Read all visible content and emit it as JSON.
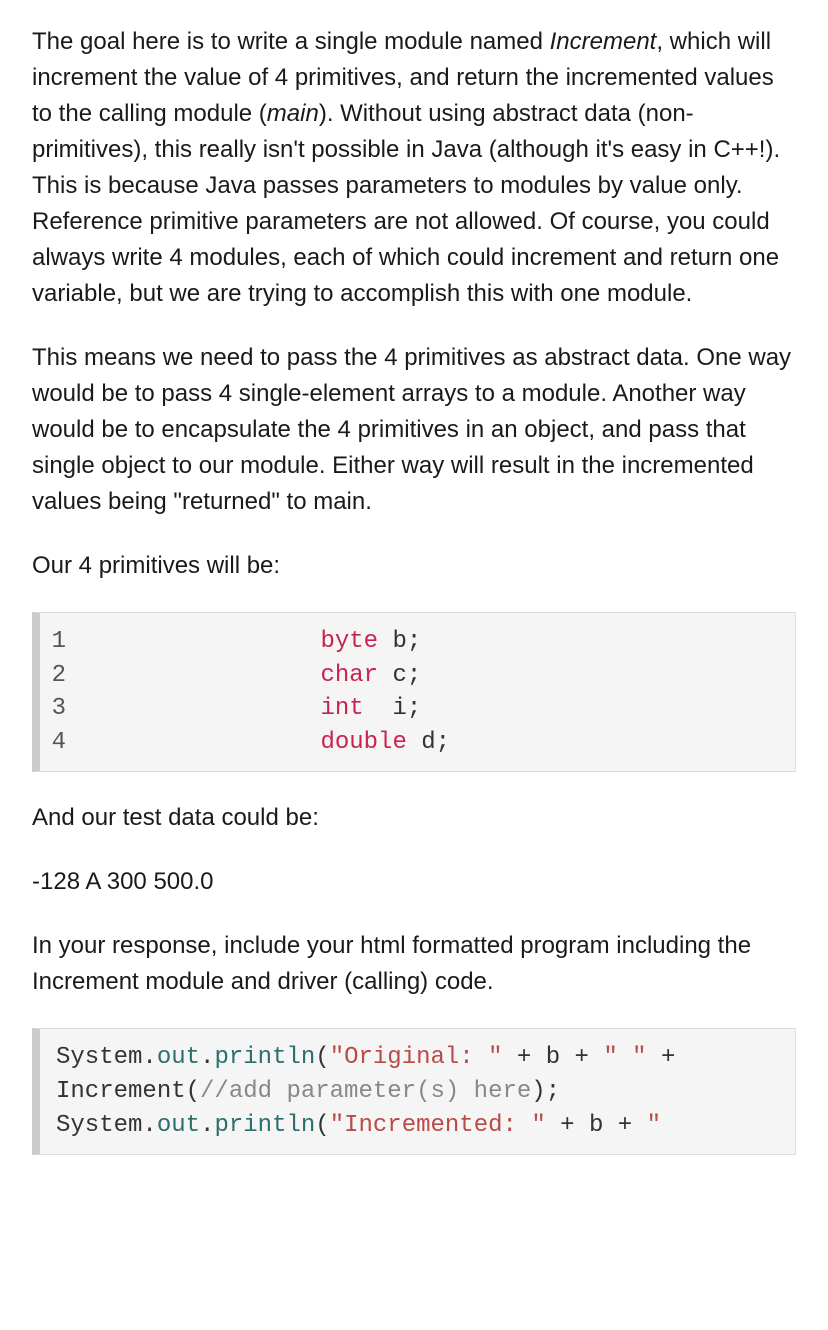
{
  "paragraphs": {
    "p1_a": "The goal here is to write a single module named ",
    "p1_em1": "Increment",
    "p1_b": ", which will increment the value of 4 primitives, and return the incremented values to the calling module (",
    "p1_em2": "main",
    "p1_c": ").  Without using abstract data (non-primitives), this really isn't possible in Java (although it's easy in C++!). This is because Java passes parameters to modules by value only. Reference primitive parameters are not allowed. Of course, you could always write 4 modules, each of which could increment and return one variable, but we are trying to accomplish this with one module.",
    "p2": "This means we need to pass the 4 primitives as abstract data. One way would be to pass 4 single-element arrays to a module. Another way would be to encapsulate the 4 primitives in an object, and pass that single object to our module. Either way will result in the incremented values being \"returned\" to main.",
    "p3": "Our 4 primitives will be:",
    "p4": "And our test data could be:",
    "p5": "-128 A 300 500.0",
    "p6": "In your response, include your html formatted program including the Increment module and driver (calling) code."
  },
  "code1": {
    "lines": [
      {
        "n": "1",
        "indent": "                ",
        "kw": "byte",
        "sp": " ",
        "id": "b",
        "end": ";"
      },
      {
        "n": "2",
        "indent": "                ",
        "kw": "char",
        "sp": " ",
        "id": "c",
        "end": ";"
      },
      {
        "n": "3",
        "indent": "                ",
        "kw": "int",
        "sp": "  ",
        "id": "i",
        "end": ";"
      },
      {
        "n": "4",
        "indent": "                ",
        "kw": "double",
        "sp": " ",
        "id": "d",
        "end": ";"
      }
    ]
  },
  "code2": {
    "l1": {
      "cls": "System",
      "d1": ".",
      "fld": "out",
      "d2": ".",
      "mth": "println",
      "op1": "(",
      "str": "\"Original: \"",
      "mid": " + b + ",
      "str2": "\" \"",
      "op2": " +"
    },
    "l2": {
      "call": "Increment(",
      "comm": "//add parameter(s) here",
      "end": ");"
    },
    "l3": {
      "cls": "System",
      "d1": ".",
      "fld": "out",
      "d2": ".",
      "mth": "println",
      "op1": "(",
      "str": "\"Incremented: \"",
      "mid": " + b + ",
      "str2": "\""
    }
  }
}
